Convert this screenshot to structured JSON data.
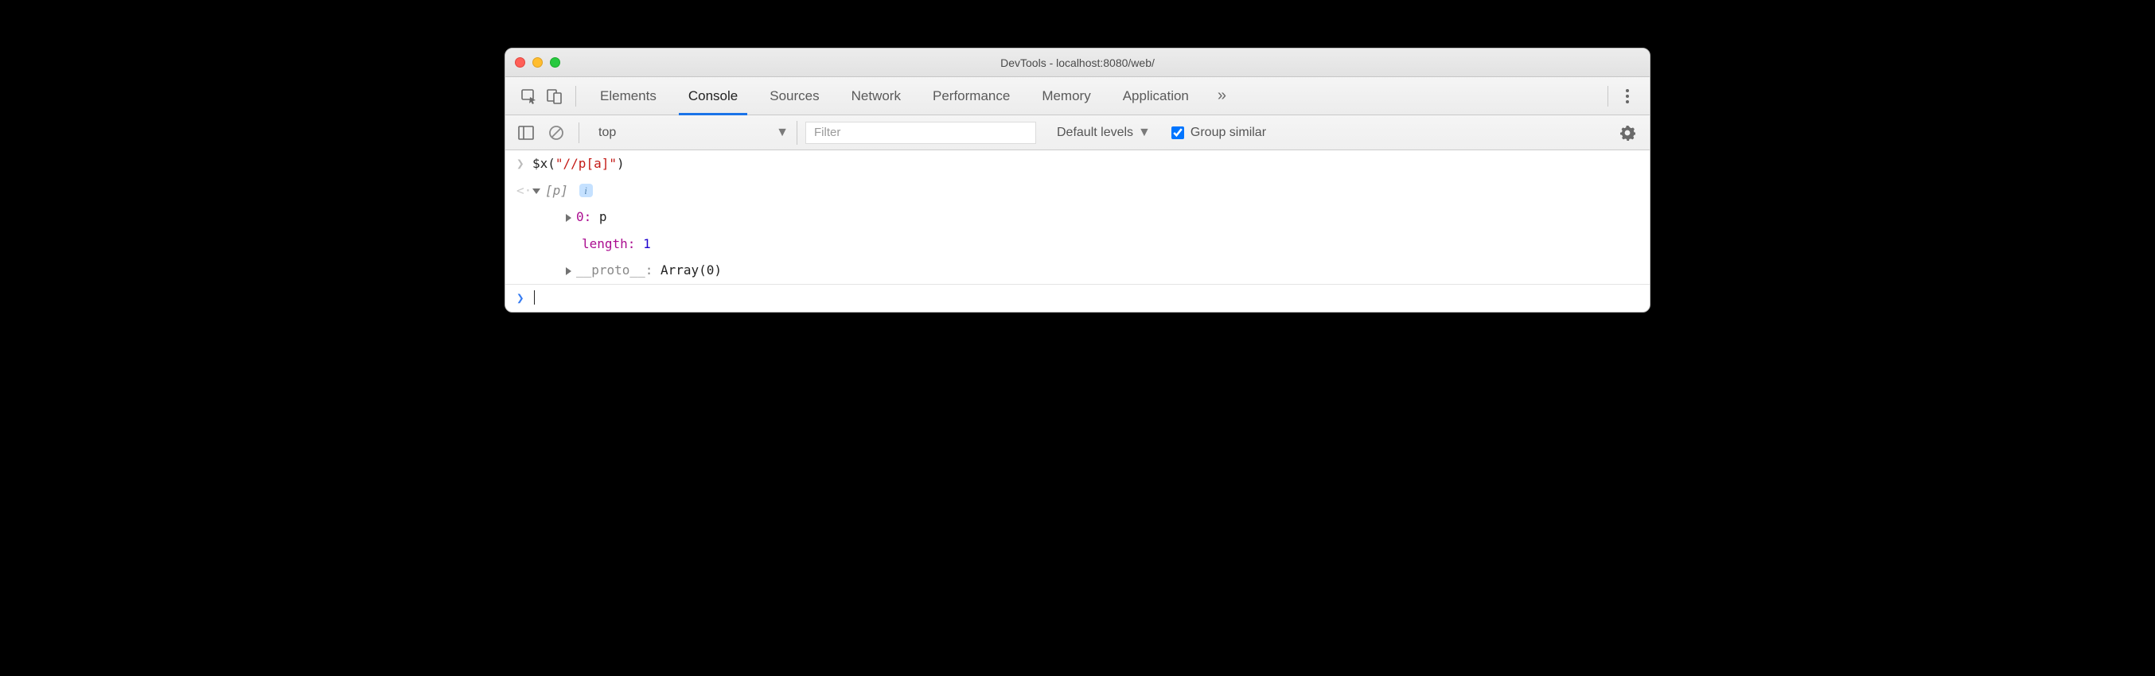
{
  "window": {
    "title": "DevTools - localhost:8080/web/"
  },
  "tabs": {
    "items": [
      "Elements",
      "Console",
      "Sources",
      "Network",
      "Performance",
      "Memory",
      "Application"
    ],
    "active": "Console"
  },
  "filterbar": {
    "context": "top",
    "filter_placeholder": "Filter",
    "level_label": "Default levels",
    "group_similar_label": "Group similar",
    "group_similar_checked": true
  },
  "console": {
    "input": {
      "fn": "$x",
      "arg_string": "\"//p[a]\""
    },
    "result": {
      "summary_open": "[",
      "summary_tag": "p",
      "summary_close": "]",
      "lines": [
        {
          "kind": "entry",
          "key": "0",
          "value": "p",
          "expandable": true
        },
        {
          "kind": "prop",
          "key": "length",
          "value": "1"
        },
        {
          "kind": "proto",
          "key": "__proto__",
          "value": "Array(0)",
          "expandable": true
        }
      ]
    }
  }
}
